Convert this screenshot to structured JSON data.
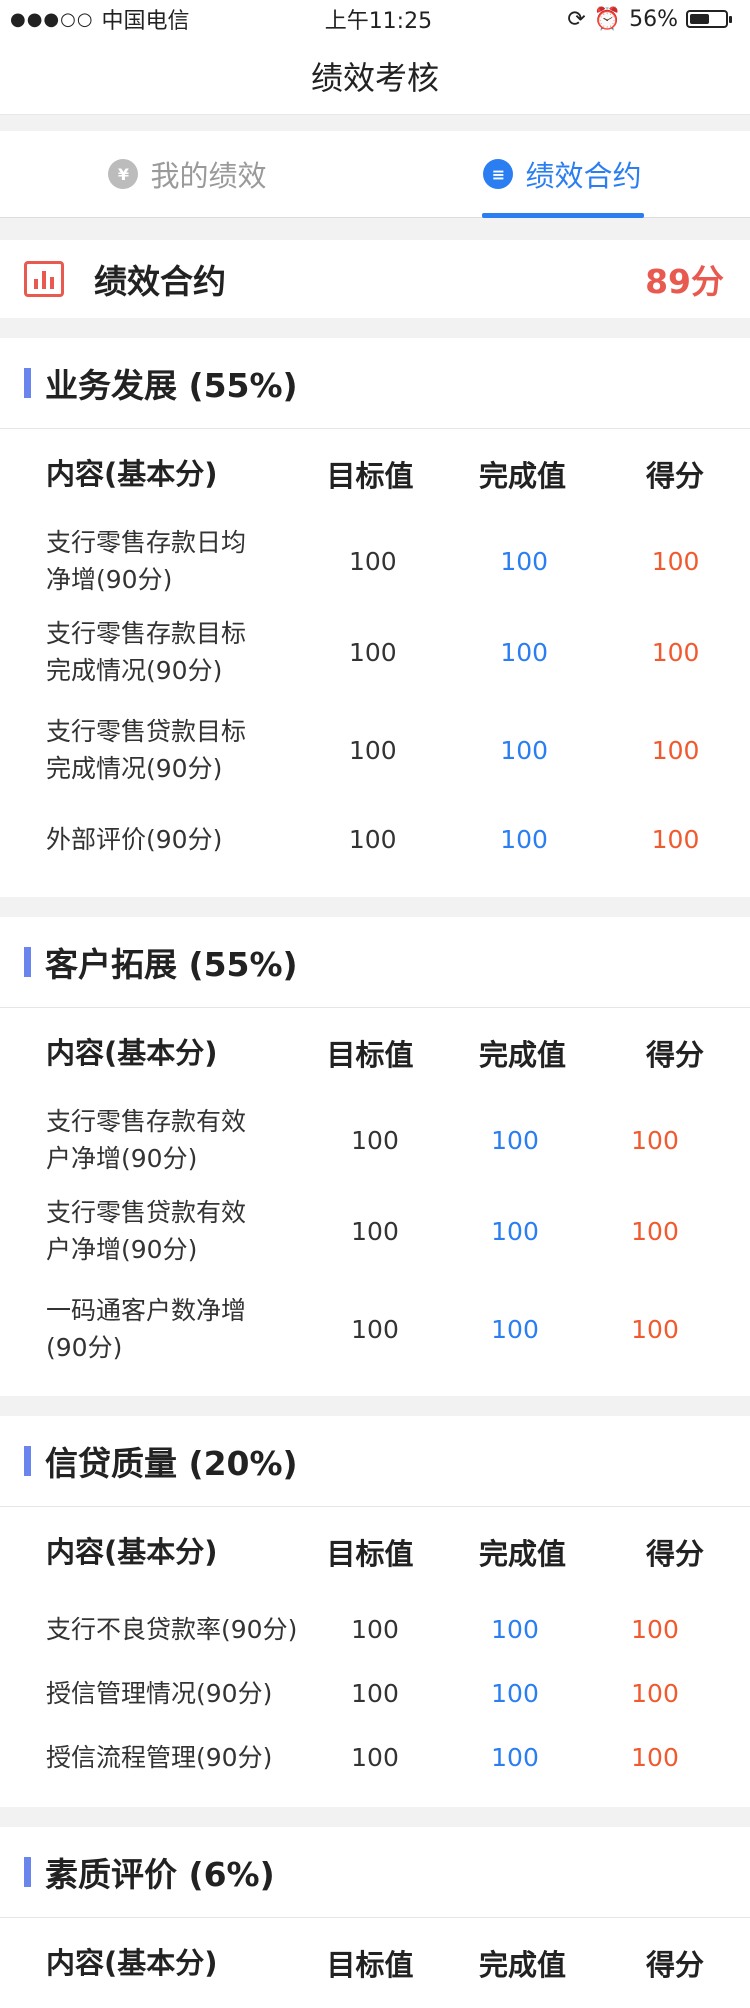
{
  "status_bar": {
    "carrier": "中国电信",
    "signal": "●●●○○",
    "time": "上午11:25",
    "battery_percent_text": "56%",
    "battery_level": 0.56
  },
  "nav": {
    "title": "绩效考核"
  },
  "tabs": [
    {
      "label": "我的绩效",
      "icon": "yen-icon",
      "icon_glyph": "¥",
      "active": false
    },
    {
      "label": "绩效合约",
      "icon": "document-icon",
      "icon_glyph": "≡",
      "active": true
    }
  ],
  "summary": {
    "title": "绩效合约",
    "score": "89分"
  },
  "table_headers": {
    "name": "内容(基本分)",
    "target": "目标值",
    "done": "完成值",
    "score": "得分"
  },
  "sections": [
    {
      "title": "业务发展 (55%)",
      "rows": [
        {
          "name": "支行零售存款日均净增(90分)",
          "target": "100",
          "done": "100",
          "score": "100"
        },
        {
          "name": "支行零售存款目标完成情况(90分)",
          "target": "100",
          "done": "100",
          "score": "100"
        },
        {
          "name": "支行零售贷款目标完成情况(90分)",
          "target": "100",
          "done": "100",
          "score": "100"
        },
        {
          "name": "外部评价(90分)",
          "target": "100",
          "done": "100",
          "score": "100"
        }
      ]
    },
    {
      "title": "客户拓展 (55%)",
      "rows": [
        {
          "name": "支行零售存款有效户净增(90分)",
          "target": "100",
          "done": "100",
          "score": "100"
        },
        {
          "name": "支行零售贷款有效户净增(90分)",
          "target": "100",
          "done": "100",
          "score": "100"
        },
        {
          "name": "一码通客户数净增(90分)",
          "target": "100",
          "done": "100",
          "score": "100"
        }
      ]
    },
    {
      "title": "信贷质量 (20%)",
      "rows": [
        {
          "name": "支行不良贷款率(90分)",
          "target": "100",
          "done": "100",
          "score": "100"
        },
        {
          "name": "授信管理情况(90分)",
          "target": "100",
          "done": "100",
          "score": "100"
        },
        {
          "name": "授信流程管理(90分)",
          "target": "100",
          "done": "100",
          "score": "100"
        }
      ]
    },
    {
      "title": "素质评价 (6%)",
      "rows": []
    }
  ],
  "colors": {
    "accent_blue": "#2b7ef2",
    "score_red": "#f05a2f",
    "section_bar": "#6b85ef"
  }
}
